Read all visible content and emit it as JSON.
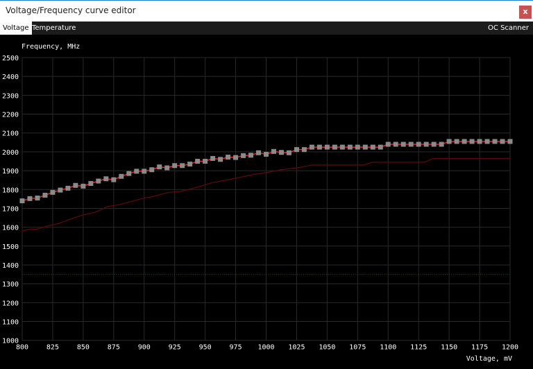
{
  "window": {
    "title": "Voltage/Frequency curve editor",
    "close_label": "x"
  },
  "tabs": [
    {
      "label": "Voltage",
      "active": true
    },
    {
      "label": "Temperature",
      "active": false
    }
  ],
  "oc_scanner_label": "OC Scanner",
  "colors": {
    "curve": "#ff2020",
    "point": "#8a8a8a",
    "actual": "#5a0a0a",
    "grid": "#2a2a2a",
    "limit": "#7a1020"
  },
  "chart_data": {
    "type": "line",
    "ylabel": "Frequency, MHz",
    "xlabel": "Voltage, mV",
    "xlim": [
      800,
      1200
    ],
    "ylim": [
      1000,
      2500
    ],
    "xticks": [
      800,
      825,
      850,
      875,
      900,
      925,
      950,
      975,
      1000,
      1025,
      1050,
      1075,
      1100,
      1125,
      1150,
      1175,
      1200
    ],
    "yticks": [
      1000,
      1100,
      1200,
      1300,
      1400,
      1500,
      1600,
      1700,
      1800,
      1900,
      2000,
      2100,
      2200,
      2300,
      2400,
      2500
    ],
    "grid": true,
    "series": [
      {
        "name": "V/F curve points",
        "x_start": 800,
        "x_step": 6.25,
        "values": [
          1740,
          1752,
          1755,
          1770,
          1785,
          1797,
          1807,
          1822,
          1818,
          1832,
          1845,
          1857,
          1852,
          1870,
          1885,
          1897,
          1897,
          1905,
          1920,
          1915,
          1927,
          1927,
          1935,
          1950,
          1950,
          1965,
          1960,
          1972,
          1970,
          1980,
          1982,
          1995,
          1987,
          2002,
          1997,
          1995,
          2012,
          2012,
          2025,
          2025,
          2025,
          2025,
          2025,
          2025,
          2025,
          2025,
          2025,
          2025,
          2040,
          2040,
          2040,
          2040,
          2040,
          2040,
          2040,
          2040,
          2055,
          2055,
          2055,
          2055,
          2055,
          2055,
          2055,
          2055,
          2055
        ]
      },
      {
        "name": "actual curve",
        "x": [
          800,
          806,
          812,
          820,
          830,
          845,
          850,
          860,
          870,
          880,
          900,
          905,
          920,
          930,
          945,
          955,
          975,
          990,
          1000,
          1012,
          1025,
          1030,
          1037,
          1080,
          1087,
          1130,
          1137,
          1200
        ],
        "values": [
          1580,
          1590,
          1590,
          1605,
          1620,
          1655,
          1665,
          1680,
          1710,
          1720,
          1755,
          1760,
          1785,
          1790,
          1815,
          1835,
          1860,
          1880,
          1890,
          1905,
          1915,
          1920,
          1930,
          1930,
          1945,
          1945,
          1965,
          1965
        ]
      },
      {
        "name": "limit line",
        "y": 1350
      }
    ]
  }
}
